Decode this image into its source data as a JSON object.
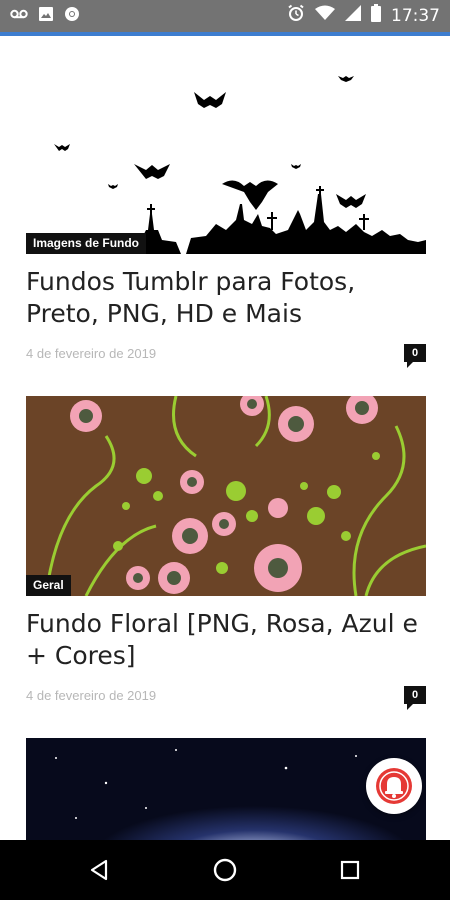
{
  "status_bar": {
    "time": "17:37",
    "left_icons": [
      "voicemail-icon",
      "image-icon",
      "chrome-icon"
    ],
    "right_icons": [
      "alarm-icon",
      "wifi-icon",
      "signal-icon",
      "battery-icon"
    ]
  },
  "articles": [
    {
      "category": "Imagens de Fundo",
      "title": "Fundos Tumblr para Fotos, Preto, PNG, HD e Mais",
      "date": "4 de fevereiro de 2019",
      "comments": "0"
    },
    {
      "category": "Geral",
      "title": "Fundo Floral [PNG, Rosa, Azul e + Cores]",
      "date": "4 de fevereiro de 2019",
      "comments": "0"
    }
  ],
  "colors": {
    "status_bar": "#737373",
    "accent_line": "#3d7dcf",
    "bell": "#e53935"
  },
  "nav": [
    "back-icon",
    "home-icon",
    "recents-icon"
  ]
}
